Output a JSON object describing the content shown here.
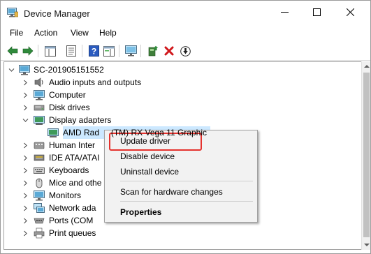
{
  "window": {
    "title": "Device Manager",
    "controls": {
      "minimize": "—",
      "maximize": "☐",
      "close": "✕"
    }
  },
  "menubar": {
    "file": "File",
    "action": "Action",
    "view": "View",
    "help": "Help"
  },
  "toolbar": {
    "buttons": [
      "back-arrow-icon",
      "forward-arrow-icon",
      "show-hide-console-tree-icon",
      "properties-sheet-icon",
      "help-icon",
      "action-pane-icon",
      "monitor-icon",
      "update-driver-icon",
      "uninstall-x-icon",
      "download-icon"
    ],
    "colors": {
      "back": "#2f8a3b",
      "forward": "#2f8a3b",
      "help": "#2b5bbf",
      "uninstall": "#d0171b"
    }
  },
  "tree": {
    "root": "SC-201905151552",
    "items": [
      {
        "label": "Audio inputs and outputs",
        "icon": "speaker-icon",
        "expanded": false
      },
      {
        "label": "Computer",
        "icon": "computer-icon",
        "expanded": false
      },
      {
        "label": "Disk drives",
        "icon": "disk-drive-icon",
        "expanded": false
      },
      {
        "label": "Display adapters",
        "icon": "display-adapter-icon",
        "expanded": true
      },
      {
        "label": "AMD Rad       (TM) RX Vega 11 Graphic",
        "icon": "display-adapter-icon",
        "child": true,
        "selected": true
      },
      {
        "label": "Human Inter",
        "icon": "hid-icon",
        "expanded": false
      },
      {
        "label": "IDE ATA/ATAI",
        "icon": "ide-controller-icon",
        "expanded": false
      },
      {
        "label": "Keyboards",
        "icon": "keyboard-icon",
        "expanded": false
      },
      {
        "label": "Mice and othe",
        "icon": "mouse-icon",
        "expanded": false
      },
      {
        "label": "Monitors",
        "icon": "monitor-icon",
        "expanded": false
      },
      {
        "label": "Network ada",
        "icon": "network-adapter-icon",
        "expanded": false
      },
      {
        "label": "Ports (COM",
        "icon": "port-icon",
        "expanded": false
      },
      {
        "label": "Print queues",
        "icon": "printer-icon",
        "expanded": false
      }
    ]
  },
  "context_menu": {
    "items": [
      {
        "label": "Update driver",
        "highlighted": true
      },
      {
        "label": "Disable device"
      },
      {
        "label": "Uninstall device"
      },
      {
        "label": "Scan for hardware changes"
      },
      {
        "label": "Properties",
        "bold": true
      }
    ],
    "highlight_color": "#e5322d"
  },
  "colors": {
    "selection": "#cce8ff",
    "menu_bg": "#f2f2f2"
  }
}
